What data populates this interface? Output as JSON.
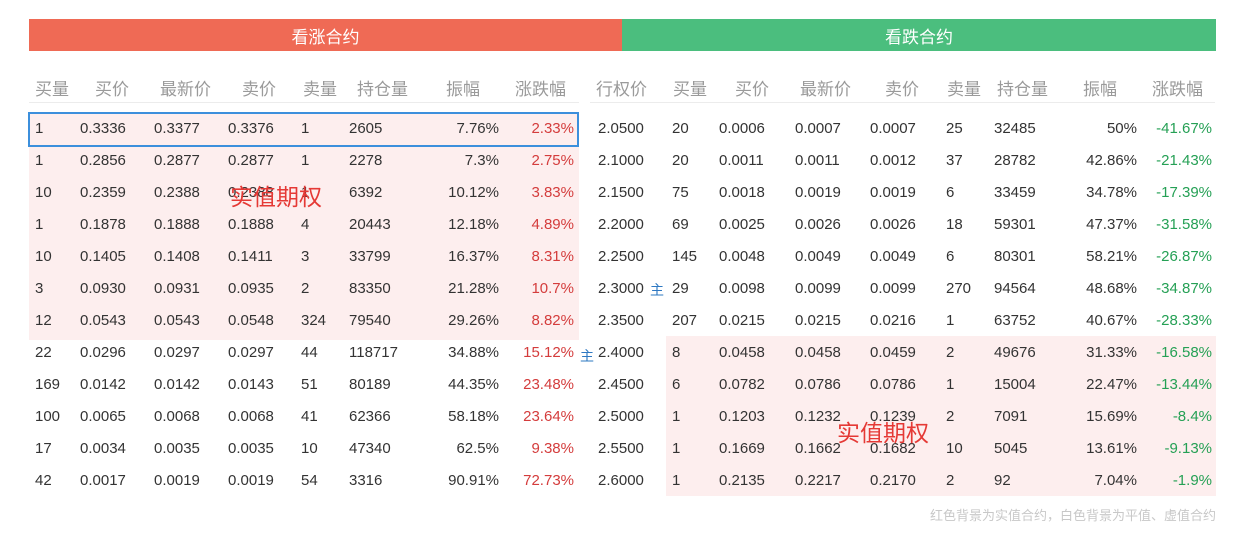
{
  "call_title": "看涨合约",
  "put_title": "看跌合约",
  "headers": {
    "call": [
      "买量",
      "买价",
      "最新价",
      "卖价",
      "卖量",
      "持仓量",
      "振幅",
      "涨跌幅"
    ],
    "strike": "行权价",
    "put": [
      "买量",
      "买价",
      "最新价",
      "卖价",
      "卖量",
      "持仓量",
      "振幅",
      "涨跌幅"
    ]
  },
  "in_the_money_label": "实值期权",
  "main_contract_mark": "主",
  "footnote": "红色背景为实值合约，白色背景为平值、虚值合约",
  "rows": [
    {
      "strike": "2.0500",
      "call": [
        "1",
        "0.3336",
        "0.3377",
        "0.3376",
        "1",
        "2605",
        "7.76%",
        "2.33%"
      ],
      "put": [
        "20",
        "0.0006",
        "0.0007",
        "0.0007",
        "25",
        "32485",
        "50%",
        "-41.67%"
      ],
      "call_itm": true,
      "put_itm": false
    },
    {
      "strike": "2.1000",
      "call": [
        "1",
        "0.2856",
        "0.2877",
        "0.2877",
        "1",
        "2278",
        "7.3%",
        "2.75%"
      ],
      "put": [
        "20",
        "0.0011",
        "0.0011",
        "0.0012",
        "37",
        "28782",
        "42.86%",
        "-21.43%"
      ],
      "call_itm": true,
      "put_itm": false
    },
    {
      "strike": "2.1500",
      "call": [
        "10",
        "0.2359",
        "0.2388",
        "0.2388",
        "1",
        "6392",
        "10.12%",
        "3.83%"
      ],
      "put": [
        "75",
        "0.0018",
        "0.0019",
        "0.0019",
        "6",
        "33459",
        "34.78%",
        "-17.39%"
      ],
      "call_itm": true,
      "put_itm": false
    },
    {
      "strike": "2.2000",
      "call": [
        "1",
        "0.1878",
        "0.1888",
        "0.1888",
        "4",
        "20443",
        "12.18%",
        "4.89%"
      ],
      "put": [
        "69",
        "0.0025",
        "0.0026",
        "0.0026",
        "18",
        "59301",
        "47.37%",
        "-31.58%"
      ],
      "call_itm": true,
      "put_itm": false
    },
    {
      "strike": "2.2500",
      "call": [
        "10",
        "0.1405",
        "0.1408",
        "0.1411",
        "3",
        "33799",
        "16.37%",
        "8.31%"
      ],
      "put": [
        "145",
        "0.0048",
        "0.0049",
        "0.0049",
        "6",
        "80301",
        "58.21%",
        "-26.87%"
      ],
      "call_itm": true,
      "put_itm": false
    },
    {
      "strike": "2.3000",
      "call": [
        "3",
        "0.0930",
        "0.0931",
        "0.0935",
        "2",
        "83350",
        "21.28%",
        "10.7%"
      ],
      "put": [
        "29",
        "0.0098",
        "0.0099",
        "0.0099",
        "270",
        "94564",
        "48.68%",
        "-34.87%"
      ],
      "call_itm": true,
      "put_itm": false
    },
    {
      "strike": "2.3500",
      "call": [
        "12",
        "0.0543",
        "0.0543",
        "0.0548",
        "324",
        "79540",
        "29.26%",
        "8.82%"
      ],
      "put": [
        "207",
        "0.0215",
        "0.0215",
        "0.0216",
        "1",
        "63752",
        "40.67%",
        "-28.33%"
      ],
      "call_itm": true,
      "put_itm": false
    },
    {
      "strike": "2.4000",
      "call": [
        "22",
        "0.0296",
        "0.0297",
        "0.0297",
        "44",
        "118717",
        "34.88%",
        "15.12%"
      ],
      "put": [
        "8",
        "0.0458",
        "0.0458",
        "0.0459",
        "2",
        "49676",
        "31.33%",
        "-16.58%"
      ],
      "call_itm": false,
      "put_itm": true
    },
    {
      "strike": "2.4500",
      "call": [
        "169",
        "0.0142",
        "0.0142",
        "0.0143",
        "51",
        "80189",
        "44.35%",
        "23.48%"
      ],
      "put": [
        "6",
        "0.0782",
        "0.0786",
        "0.0786",
        "1",
        "15004",
        "22.47%",
        "-13.44%"
      ],
      "call_itm": false,
      "put_itm": true
    },
    {
      "strike": "2.5000",
      "call": [
        "100",
        "0.0065",
        "0.0068",
        "0.0068",
        "41",
        "62366",
        "58.18%",
        "23.64%"
      ],
      "put": [
        "1",
        "0.1203",
        "0.1232",
        "0.1239",
        "2",
        "7091",
        "15.69%",
        "-8.4%"
      ],
      "call_itm": false,
      "put_itm": true
    },
    {
      "strike": "2.5500",
      "call": [
        "17",
        "0.0034",
        "0.0035",
        "0.0035",
        "10",
        "47340",
        "62.5%",
        "9.38%"
      ],
      "put": [
        "1",
        "0.1669",
        "0.1662",
        "0.1682",
        "10",
        "5045",
        "13.61%",
        "-9.13%"
      ],
      "call_itm": false,
      "put_itm": true
    },
    {
      "strike": "2.6000",
      "call": [
        "42",
        "0.0017",
        "0.0019",
        "0.0019",
        "54",
        "3316",
        "90.91%",
        "72.73%"
      ],
      "put": [
        "1",
        "0.2135",
        "0.2217",
        "0.2170",
        "2",
        "92",
        "7.04%",
        "-1.9%"
      ],
      "call_itm": false,
      "put_itm": true
    }
  ]
}
